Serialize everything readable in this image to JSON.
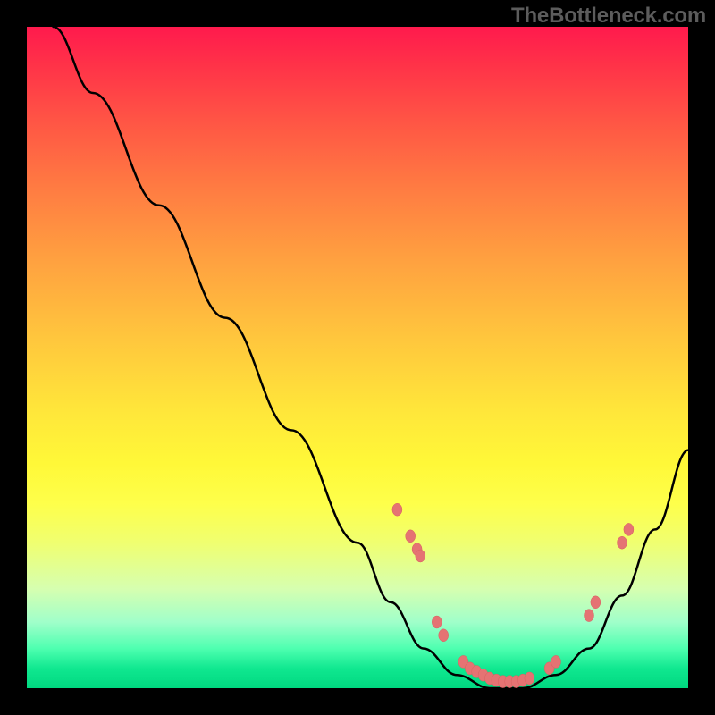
{
  "watermark": "TheBottleneck.com",
  "chart_data": {
    "type": "line",
    "title": "",
    "xlabel": "",
    "ylabel": "",
    "xlim": [
      0,
      100
    ],
    "ylim": [
      0,
      100
    ],
    "series": [
      {
        "name": "bottleneck-curve",
        "x": [
          4,
          10,
          20,
          30,
          40,
          50,
          55,
          60,
          65,
          70,
          75,
          80,
          85,
          90,
          95,
          100
        ],
        "y": [
          100,
          90,
          73,
          56,
          39,
          22,
          13,
          6,
          2,
          0,
          0,
          2,
          6,
          14,
          24,
          36
        ]
      }
    ],
    "points": [
      {
        "x": 56,
        "y": 27
      },
      {
        "x": 58,
        "y": 23
      },
      {
        "x": 59,
        "y": 21
      },
      {
        "x": 59.5,
        "y": 20
      },
      {
        "x": 62,
        "y": 10
      },
      {
        "x": 63,
        "y": 8
      },
      {
        "x": 66,
        "y": 4
      },
      {
        "x": 67,
        "y": 3
      },
      {
        "x": 68,
        "y": 2.5
      },
      {
        "x": 69,
        "y": 2
      },
      {
        "x": 70,
        "y": 1.5
      },
      {
        "x": 71,
        "y": 1.2
      },
      {
        "x": 72,
        "y": 1
      },
      {
        "x": 73,
        "y": 1
      },
      {
        "x": 74,
        "y": 1
      },
      {
        "x": 75,
        "y": 1.2
      },
      {
        "x": 76,
        "y": 1.5
      },
      {
        "x": 79,
        "y": 3
      },
      {
        "x": 80,
        "y": 4
      },
      {
        "x": 85,
        "y": 11
      },
      {
        "x": 86,
        "y": 13
      },
      {
        "x": 90,
        "y": 22
      },
      {
        "x": 91,
        "y": 24
      }
    ]
  }
}
